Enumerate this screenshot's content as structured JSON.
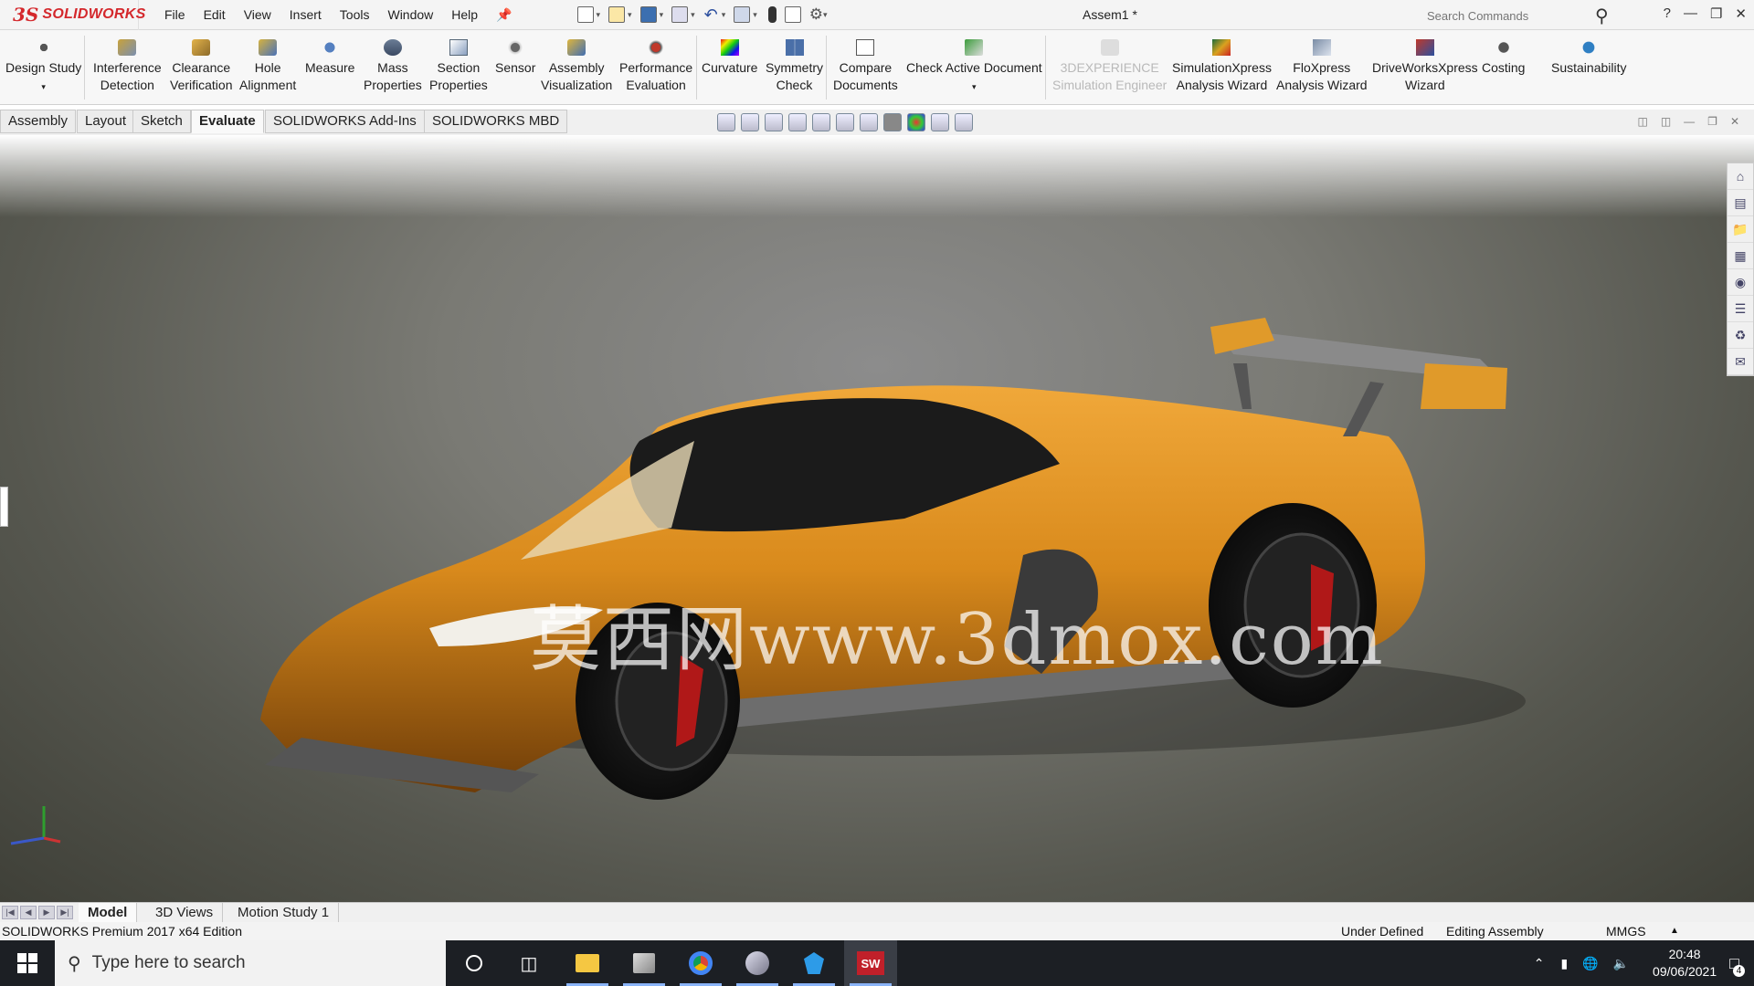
{
  "app": {
    "brand_ds": "3S",
    "brand_name": "SOLIDWORKS",
    "document_title": "Assem1 *"
  },
  "menu": [
    "File",
    "Edit",
    "View",
    "Insert",
    "Tools",
    "Window",
    "Help"
  ],
  "search": {
    "placeholder": "Search Commands"
  },
  "commands": [
    {
      "label1": "Design Study",
      "label2": "",
      "icon": "design-study-icon"
    },
    {
      "label1": "Interference",
      "label2": "Detection",
      "icon": "interference-icon"
    },
    {
      "label1": "Clearance",
      "label2": "Verification",
      "icon": "clearance-icon"
    },
    {
      "label1": "Hole",
      "label2": "Alignment",
      "icon": "hole-alignment-icon"
    },
    {
      "label1": "Measure",
      "label2": "",
      "icon": "measure-icon"
    },
    {
      "label1": "Mass",
      "label2": "Properties",
      "icon": "mass-properties-icon"
    },
    {
      "label1": "Section",
      "label2": "Properties",
      "icon": "section-properties-icon"
    },
    {
      "label1": "Sensor",
      "label2": "",
      "icon": "sensor-icon"
    },
    {
      "label1": "Assembly",
      "label2": "Visualization",
      "icon": "assembly-visualization-icon"
    },
    {
      "label1": "Performance",
      "label2": "Evaluation",
      "icon": "performance-icon"
    },
    {
      "label1": "Curvature",
      "label2": "",
      "icon": "curvature-icon"
    },
    {
      "label1": "Symmetry",
      "label2": "Check",
      "icon": "symmetry-icon"
    },
    {
      "label1": "Compare",
      "label2": "Documents",
      "icon": "compare-icon"
    },
    {
      "label1": "Check Active Document",
      "label2": "",
      "icon": "check-document-icon"
    },
    {
      "label1": "3DEXPERIENCE",
      "label2": "Simulation Engineer",
      "icon": "3dexperience-icon"
    },
    {
      "label1": "SimulationXpress",
      "label2": "Analysis Wizard",
      "icon": "simulationxpress-icon"
    },
    {
      "label1": "FloXpress",
      "label2": "Analysis Wizard",
      "icon": "floxpress-icon"
    },
    {
      "label1": "DriveWorksXpress",
      "label2": "Wizard",
      "icon": "driveworks-icon"
    },
    {
      "label1": "Costing",
      "label2": "",
      "icon": "costing-icon"
    },
    {
      "label1": "Sustainability",
      "label2": "",
      "icon": "sustainability-icon"
    }
  ],
  "tabs": [
    "Assembly",
    "Layout",
    "Sketch",
    "Evaluate",
    "SOLIDWORKS Add-Ins",
    "SOLIDWORKS MBD"
  ],
  "active_tab": "Evaluate",
  "watermark": "莫西网www.3dmox.com",
  "bottom_tabs": [
    "Model",
    "3D Views",
    "Motion Study 1"
  ],
  "status": {
    "edition": "SOLIDWORKS Premium 2017 x64 Edition",
    "definition": "Under Defined",
    "mode": "Editing Assembly",
    "units": "MMGS"
  },
  "taskbar": {
    "search_placeholder": "Type here to search",
    "time": "20:48",
    "date": "09/06/2021",
    "notification_count": "4",
    "sw_badge": "SW"
  },
  "colors": {
    "accent_red": "#d4282c",
    "car_body": "#d98a1c",
    "taskbar": "#1c1f24"
  }
}
